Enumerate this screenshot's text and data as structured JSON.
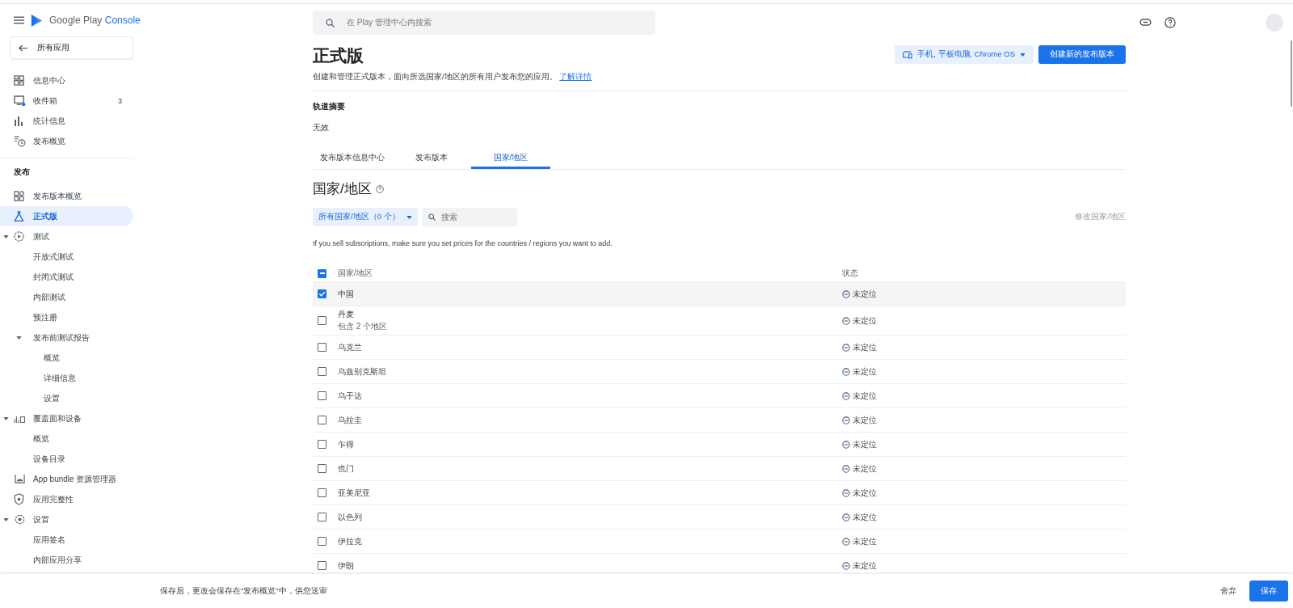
{
  "header": {
    "logo": {
      "brand": "Google Play",
      "product": "Console"
    },
    "search": {
      "placeholder": "在 Play 管理中心内搜索"
    }
  },
  "sidebar": {
    "back": "所有应用",
    "groups": [
      {
        "items": [
          {
            "label": "信息中心",
            "selected": false
          },
          {
            "label": "收件箱",
            "count": "3",
            "selected": false
          },
          {
            "label": "统计信息",
            "selected": false
          },
          {
            "label": "发布概览",
            "selected": false
          }
        ]
      },
      {
        "heading": "发布",
        "items": [
          {
            "label": "发布版本概览",
            "selected": false
          },
          {
            "label": "正式版",
            "selected": true
          },
          {
            "label": "测试",
            "selected": false,
            "expanded": true,
            "children": [
              {
                "label": "开放式测试",
                "selected": false
              },
              {
                "label": "封闭式测试",
                "selected": false
              },
              {
                "label": "内部测试",
                "selected": false
              },
              {
                "label": "预注册",
                "selected": false
              },
              {
                "label": "发布前测试报告",
                "selected": false,
                "expanded": true,
                "children": [
                  {
                    "label": "概览",
                    "selected": false
                  },
                  {
                    "label": "详细信息",
                    "selected": false
                  },
                  {
                    "label": "设置",
                    "selected": false
                  }
                ]
              }
            ]
          },
          {
            "label": "覆盖面和设备",
            "selected": false,
            "expanded": true,
            "children": [
              {
                "label": "概览",
                "selected": false
              },
              {
                "label": "设备目录",
                "selected": false
              }
            ]
          },
          {
            "label": "App bundle 资源管理器",
            "selected": false
          },
          {
            "label": "应用完整性",
            "selected": false
          },
          {
            "label": "设置",
            "selected": false,
            "expanded": true,
            "children": [
              {
                "label": "应用签名",
                "selected": false
              },
              {
                "label": "内部应用分享",
                "selected": false
              }
            ]
          }
        ]
      }
    ]
  },
  "page": {
    "title": "正式版",
    "description": "创建和管理正式版本，面向所选国家/地区的所有用户发布您的应用。",
    "link": "了解详情",
    "device_selector": "手机, 平板电脑, Chrome OS",
    "primary_button": "创建新的发布版本"
  },
  "track_summary": {
    "label": "轨道摘要",
    "value": "无效"
  },
  "tabs": [
    {
      "label": "发布版本信息中心",
      "selected": false
    },
    {
      "label": "发布版本",
      "selected": false
    },
    {
      "label": "国家/地区",
      "selected": true
    }
  ],
  "section": {
    "title": "国家/地区",
    "filter": "所有国家/地区（0 个）",
    "search": {
      "placeholder": "搜索"
    },
    "edit_link": {
      "label": "修改国家/地区",
      "disabled": true
    },
    "note": "If you sell subscriptions, make sure you set prices for the countries / regions you want to add."
  },
  "table": {
    "columns": [
      "国家/地区",
      "状态"
    ],
    "header_checkbox": {
      "indeterminate": true
    },
    "rows": [
      {
        "name": "中国",
        "checked": true,
        "status": "未定位"
      },
      {
        "name": "丹麦",
        "detail": "包含 2 个地区",
        "checked": false,
        "status": "未定位"
      },
      {
        "name": "乌克兰",
        "checked": false,
        "status": "未定位"
      },
      {
        "name": "乌兹别克斯坦",
        "checked": false,
        "status": "未定位"
      },
      {
        "name": "乌干达",
        "checked": false,
        "status": "未定位"
      },
      {
        "name": "乌拉圭",
        "checked": false,
        "status": "未定位"
      },
      {
        "name": "乍得",
        "checked": false,
        "status": "未定位"
      },
      {
        "name": "也门",
        "checked": false,
        "status": "未定位"
      },
      {
        "name": "亚美尼亚",
        "checked": false,
        "status": "未定位"
      },
      {
        "name": "以色列",
        "checked": false,
        "status": "未定位"
      },
      {
        "name": "伊拉克",
        "checked": false,
        "status": "未定位"
      },
      {
        "name": "伊朗",
        "checked": false,
        "status": "未定位"
      }
    ]
  },
  "footer": {
    "message": "保存后，更改会保存在\"发布概览\"中，供您送审",
    "discard": "舍弃",
    "save": "保存"
  }
}
